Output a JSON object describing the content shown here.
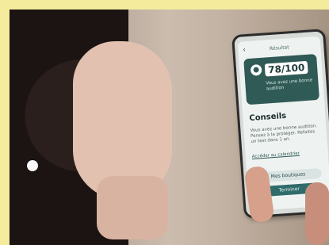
{
  "photo": {
    "phone_screen": {
      "title": "Résultat",
      "score": "78/100",
      "score_message": "Vous avez une bonne audition",
      "section_title": "Conseils",
      "section_text": "Vous avez une bonne audition. Pensez à la protéger. Refaites un test dans 1 an.",
      "link_text": "Accéder au calendrier",
      "secondary_button": "Mes boutiques",
      "primary_button": "Terminer"
    }
  }
}
